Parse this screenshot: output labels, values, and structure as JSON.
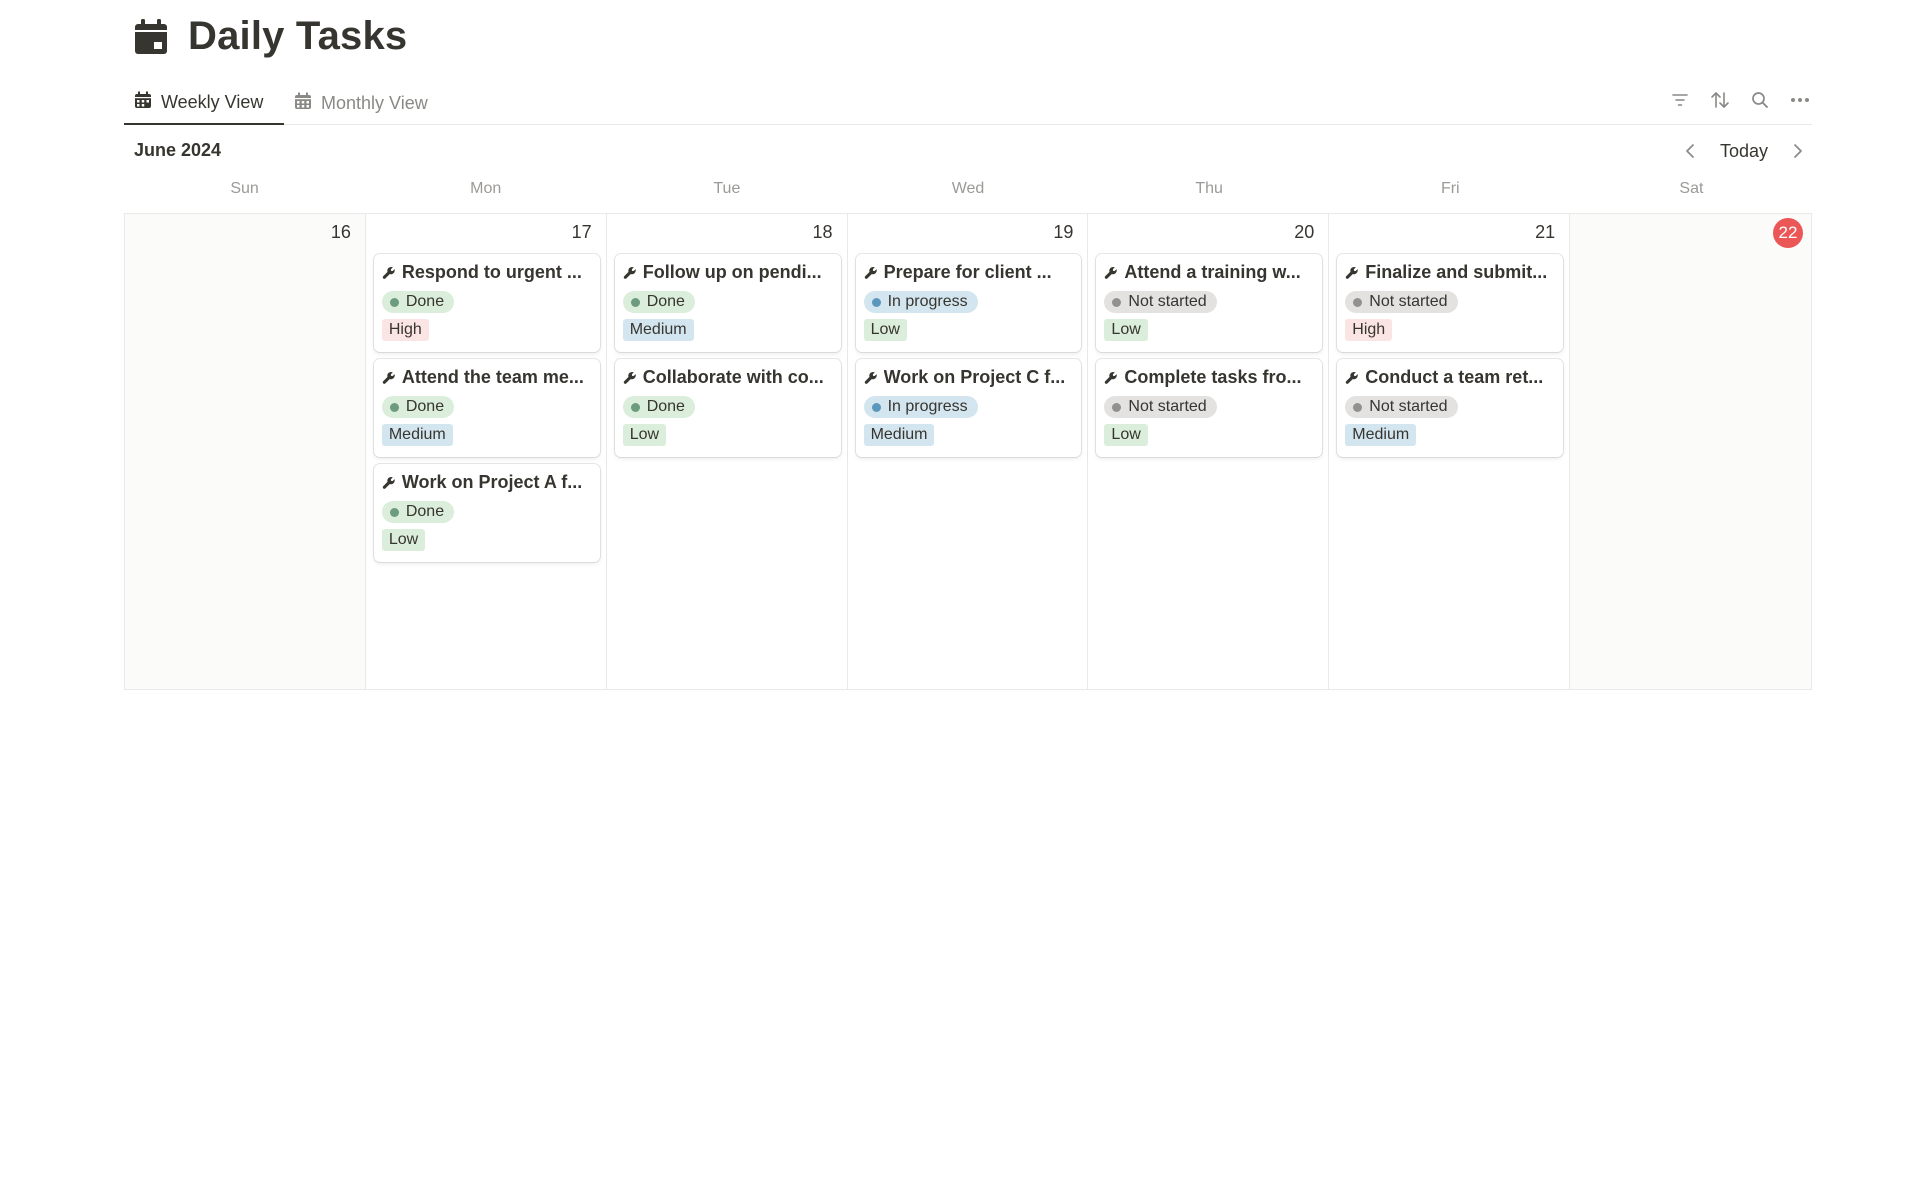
{
  "page": {
    "title": "Daily Tasks",
    "icon": "calendar-icon"
  },
  "tabs": [
    {
      "label": "Weekly View",
      "icon": "calendar-icon",
      "active": true
    },
    {
      "label": "Monthly View",
      "icon": "calendar-grid-icon",
      "active": false
    }
  ],
  "toolbar": {
    "icons": [
      "filter-icon",
      "sort-icon",
      "search-icon",
      "more-icon"
    ]
  },
  "calendar": {
    "month_label": "June 2024",
    "today_label": "Today",
    "weekday_labels": [
      "Sun",
      "Mon",
      "Tue",
      "Wed",
      "Thu",
      "Fri",
      "Sat"
    ],
    "days": [
      {
        "num": "16",
        "weekend": true,
        "today": false,
        "tasks": []
      },
      {
        "num": "17",
        "weekend": false,
        "today": false,
        "tasks": [
          {
            "title": "Respond to urgent ...",
            "status": "Done",
            "priority": "High"
          },
          {
            "title": "Attend the team me...",
            "status": "Done",
            "priority": "Medium"
          },
          {
            "title": "Work on Project A f...",
            "status": "Done",
            "priority": "Low"
          }
        ]
      },
      {
        "num": "18",
        "weekend": false,
        "today": false,
        "tasks": [
          {
            "title": "Follow up on pendi...",
            "status": "Done",
            "priority": "Medium"
          },
          {
            "title": "Collaborate with co...",
            "status": "Done",
            "priority": "Low"
          }
        ]
      },
      {
        "num": "19",
        "weekend": false,
        "today": false,
        "tasks": [
          {
            "title": "Prepare for client ...",
            "status": "In progress",
            "priority": "Low"
          },
          {
            "title": "Work on Project C f...",
            "status": "In progress",
            "priority": "Medium"
          }
        ]
      },
      {
        "num": "20",
        "weekend": false,
        "today": false,
        "tasks": [
          {
            "title": "Attend a training w...",
            "status": "Not started",
            "priority": "Low"
          },
          {
            "title": "Complete tasks fro...",
            "status": "Not started",
            "priority": "Low"
          }
        ]
      },
      {
        "num": "21",
        "weekend": false,
        "today": false,
        "tasks": [
          {
            "title": "Finalize and submit...",
            "status": "Not started",
            "priority": "High"
          },
          {
            "title": "Conduct a team ret...",
            "status": "Not started",
            "priority": "Medium"
          }
        ]
      },
      {
        "num": "22",
        "weekend": true,
        "today": true,
        "tasks": []
      }
    ]
  },
  "colors": {
    "status": {
      "Done": {
        "bg": "#dbeddb",
        "dot": "#6c9b7d"
      },
      "In progress": {
        "bg": "#d3e5ef",
        "dot": "#5b97bd"
      },
      "Not started": {
        "bg": "#e3e2e0",
        "dot": "#91918e"
      }
    },
    "priority": {
      "High": "#fbe4e4",
      "Medium": "#d3e5ef",
      "Low": "#dbeddb"
    },
    "today_badge": "#eb5757"
  }
}
